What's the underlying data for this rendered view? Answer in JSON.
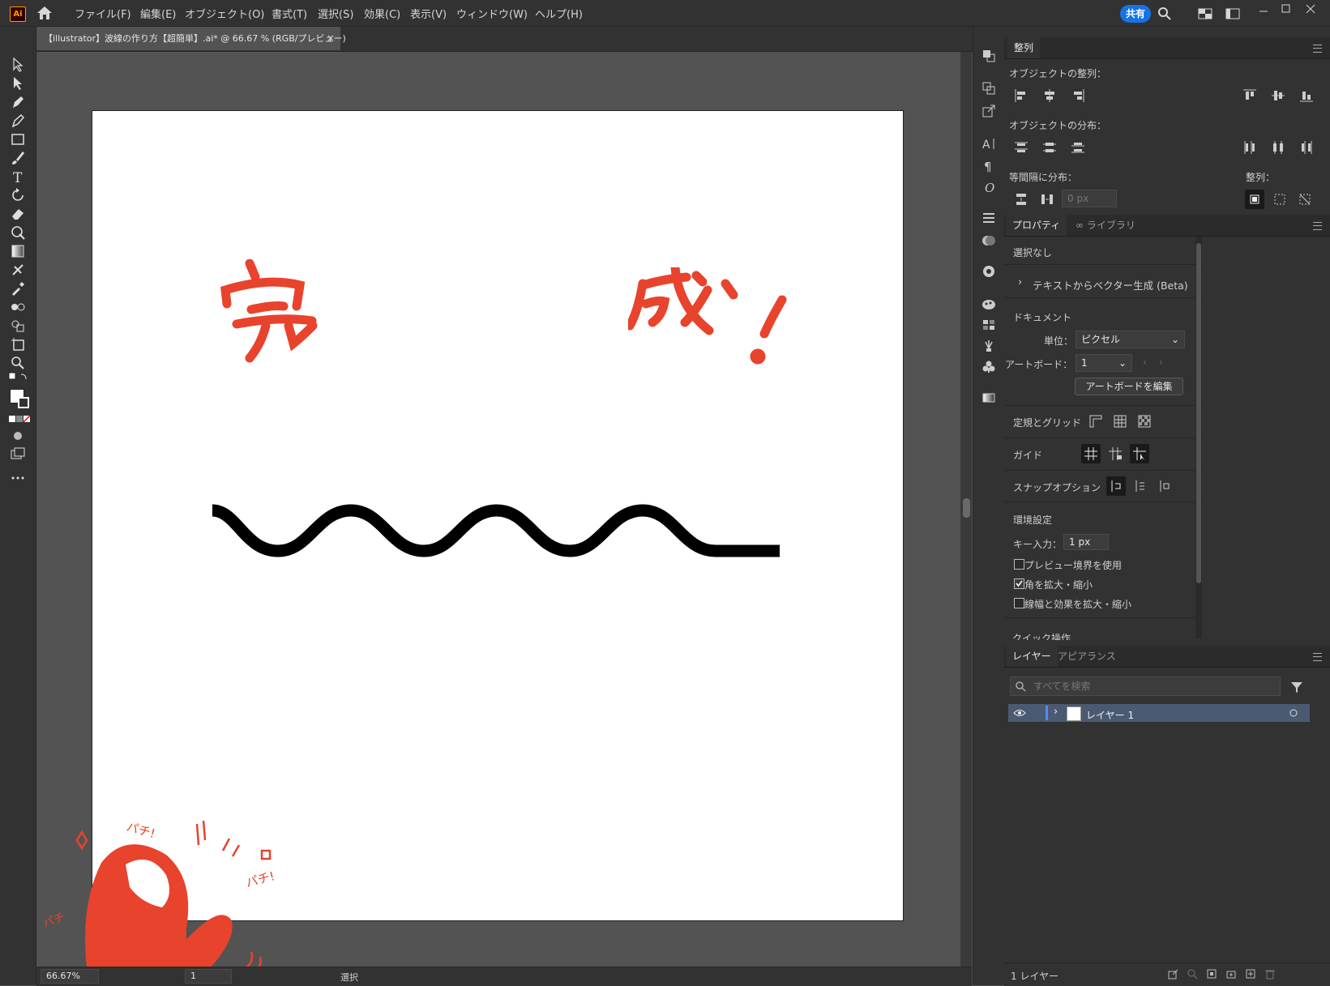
{
  "app": {
    "logo_text": "Ai"
  },
  "menu": [
    "ファイル(F)",
    "編集(E)",
    "オブジェクト(O)",
    "書式(T)",
    "選択(S)",
    "効果(C)",
    "表示(V)",
    "ウィンドウ(W)",
    "ヘルプ(H)"
  ],
  "header": {
    "share_label": "共有"
  },
  "document": {
    "tab_title": "【illustrator】波線の作り方【超簡単】.ai* @ 66.67 % (RGB/プレビュー)",
    "close": "×"
  },
  "artwork": {
    "text_left": "完",
    "text_right": "成!",
    "pachi_1": "パチ!",
    "pachi_2": "パチ!",
    "pachi_3": "パチ",
    "stroke_color": "#000000",
    "accent_color": "#e8432d"
  },
  "status": {
    "zoom": "66.67%",
    "artboard_num": "1",
    "mode": "選択"
  },
  "align_panel": {
    "tab": "整列",
    "align_objects": "オブジェクトの整列：",
    "distribute_objects": "オブジェクトの分布：",
    "distribute_spacing": "等間隔に分布：",
    "spacing_value": "0 px",
    "align_to": "整列："
  },
  "properties_panel": {
    "tabs": [
      "プロパティ",
      "ライブラリ"
    ],
    "selection": "選択なし",
    "text_to_vector": "テキストからベクター生成 (Beta)",
    "document_heading": "ドキュメント",
    "unit_label": "単位：",
    "unit_value": "ピクセル",
    "artboard_label": "アートボード：",
    "artboard_value": "1",
    "edit_artboard_btn": "アートボードを編集",
    "rulers_grids": "定規とグリッド",
    "guides": "ガイド",
    "snap_options": "スナップオプション",
    "preferences": "環境設定",
    "key_input_label": "キー入力：",
    "key_input_value": "1 px",
    "check_preview_bounds": "プレビュー境界を使用",
    "check_scale_corners": "角を拡大・縮小",
    "check_scale_strokes": "線幅と効果を拡大・縮小",
    "quick_actions": "クイック操作"
  },
  "layers_panel": {
    "tabs": [
      "レイヤー",
      "アピアランス"
    ],
    "search_placeholder": "すべてを検索",
    "layer_name": "レイヤー 1",
    "footer_count": "1 レイヤー"
  }
}
